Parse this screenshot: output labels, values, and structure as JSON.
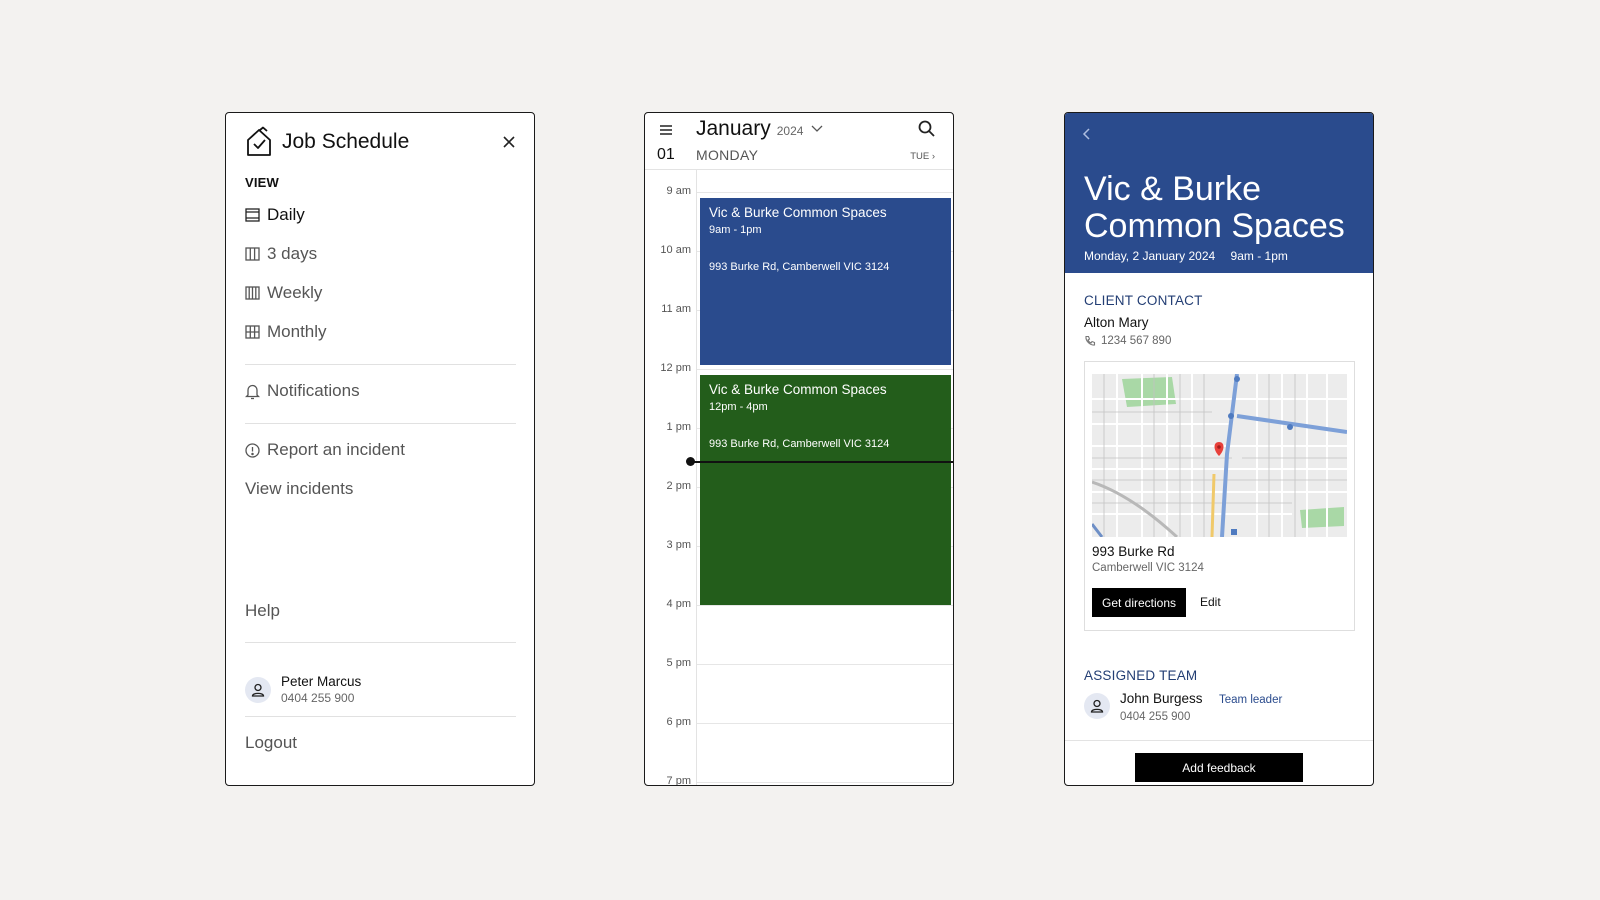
{
  "menu": {
    "title": "Job Schedule",
    "view_label": "VIEW",
    "views": [
      "Daily",
      "3 days",
      "Weekly",
      "Monthly"
    ],
    "notifications": "Notifications",
    "report_incident": "Report an incident",
    "view_incidents": "View incidents",
    "help": "Help",
    "user": {
      "name": "Peter Marcus",
      "phone": "0404 255 900"
    },
    "logout": "Logout"
  },
  "calendar": {
    "month": "January",
    "year": "2024",
    "day_number": "01",
    "weekday": "MONDAY",
    "next_day": "TUE ›",
    "hours": [
      "9 am",
      "10 am",
      "11 am",
      "12 pm",
      "1 pm",
      "2 pm",
      "3 pm",
      "4 pm",
      "5 pm",
      "6 pm",
      "7 pm"
    ],
    "events": [
      {
        "title": "Vic & Burke Common Spaces",
        "time": "9am - 1pm",
        "address": "993 Burke Rd, Camberwell VIC 3124",
        "color": "#2a4b8d"
      },
      {
        "title": "Vic & Burke Common Spaces",
        "time": "12pm - 4pm",
        "address": "993 Burke Rd, Camberwell VIC 3124",
        "color": "#235d1b"
      }
    ]
  },
  "detail": {
    "title": "Vic & Burke Common Spaces",
    "date": "Monday, 2 January 2024",
    "time": "9am - 1pm",
    "client_label": "CLIENT CONTACT",
    "client_name": "Alton Mary",
    "client_phone": "1234 567 890",
    "address_line1": "993 Burke Rd",
    "address_line2": "Camberwell VIC 3124",
    "directions_button": "Get directions",
    "edit_button": "Edit",
    "team_label": "ASSIGNED TEAM",
    "team_member": {
      "name": "John Burgess",
      "role": "Team leader",
      "phone": "0404 255 900"
    },
    "feedback_button": "Add feedback"
  },
  "colors": {
    "primary_blue": "#2a4b8d",
    "event_green": "#235d1b"
  }
}
